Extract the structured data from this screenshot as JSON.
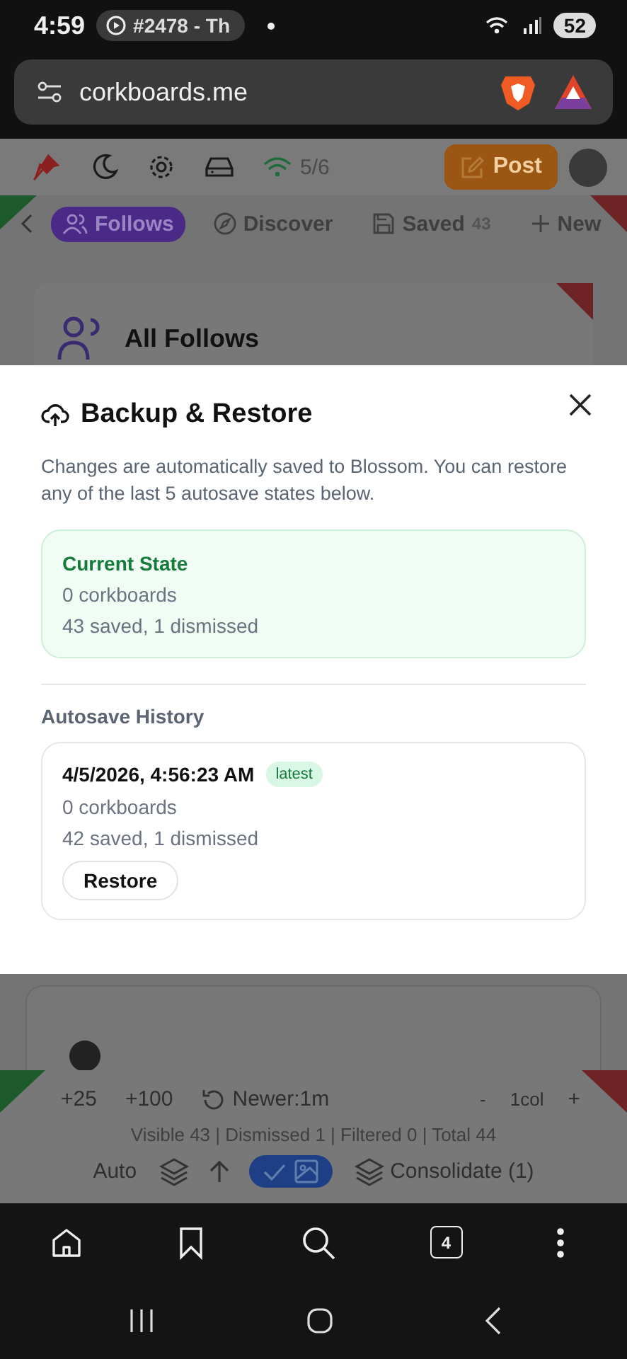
{
  "status_bar": {
    "time": "4:59",
    "media_pill": "#2478 - Th",
    "battery": "52"
  },
  "browser": {
    "url": "corkboards.me",
    "tab_count": "4"
  },
  "app_header": {
    "connections": "5/6",
    "post_button": "Post"
  },
  "tabs": [
    {
      "label": "Follows",
      "selected": true
    },
    {
      "label": "Discover",
      "selected": false
    },
    {
      "label": "Saved",
      "count": "43",
      "selected": false
    },
    {
      "label": "New",
      "selected": false
    }
  ],
  "feed_header": {
    "title": "All Follows"
  },
  "modal": {
    "title": "Backup & Restore",
    "description": "Changes are automatically saved to Blossom. You can restore any of the last 5 autosave states below.",
    "current_state": {
      "heading": "Current State",
      "boards": "0 corkboards",
      "counts": "43 saved, 1 dismissed"
    },
    "history_heading": "Autosave History",
    "history": [
      {
        "timestamp": "4/5/2026, 4:56:23 AM",
        "latest": true,
        "badge": "latest",
        "boards": "0 corkboards",
        "counts": "42 saved, 1 dismissed",
        "button": "Restore"
      }
    ]
  },
  "toolbar": {
    "load_buttons": [
      "+25",
      "+100"
    ],
    "newer": "Newer:1m",
    "minus": "-",
    "columns": "1col",
    "plus": "+",
    "stats": "Visible 43 | Dismissed 1 | Filtered 0 | Total 44",
    "auto": "Auto",
    "image_filter_on": true,
    "consolidate": "Consolidate (1)"
  }
}
